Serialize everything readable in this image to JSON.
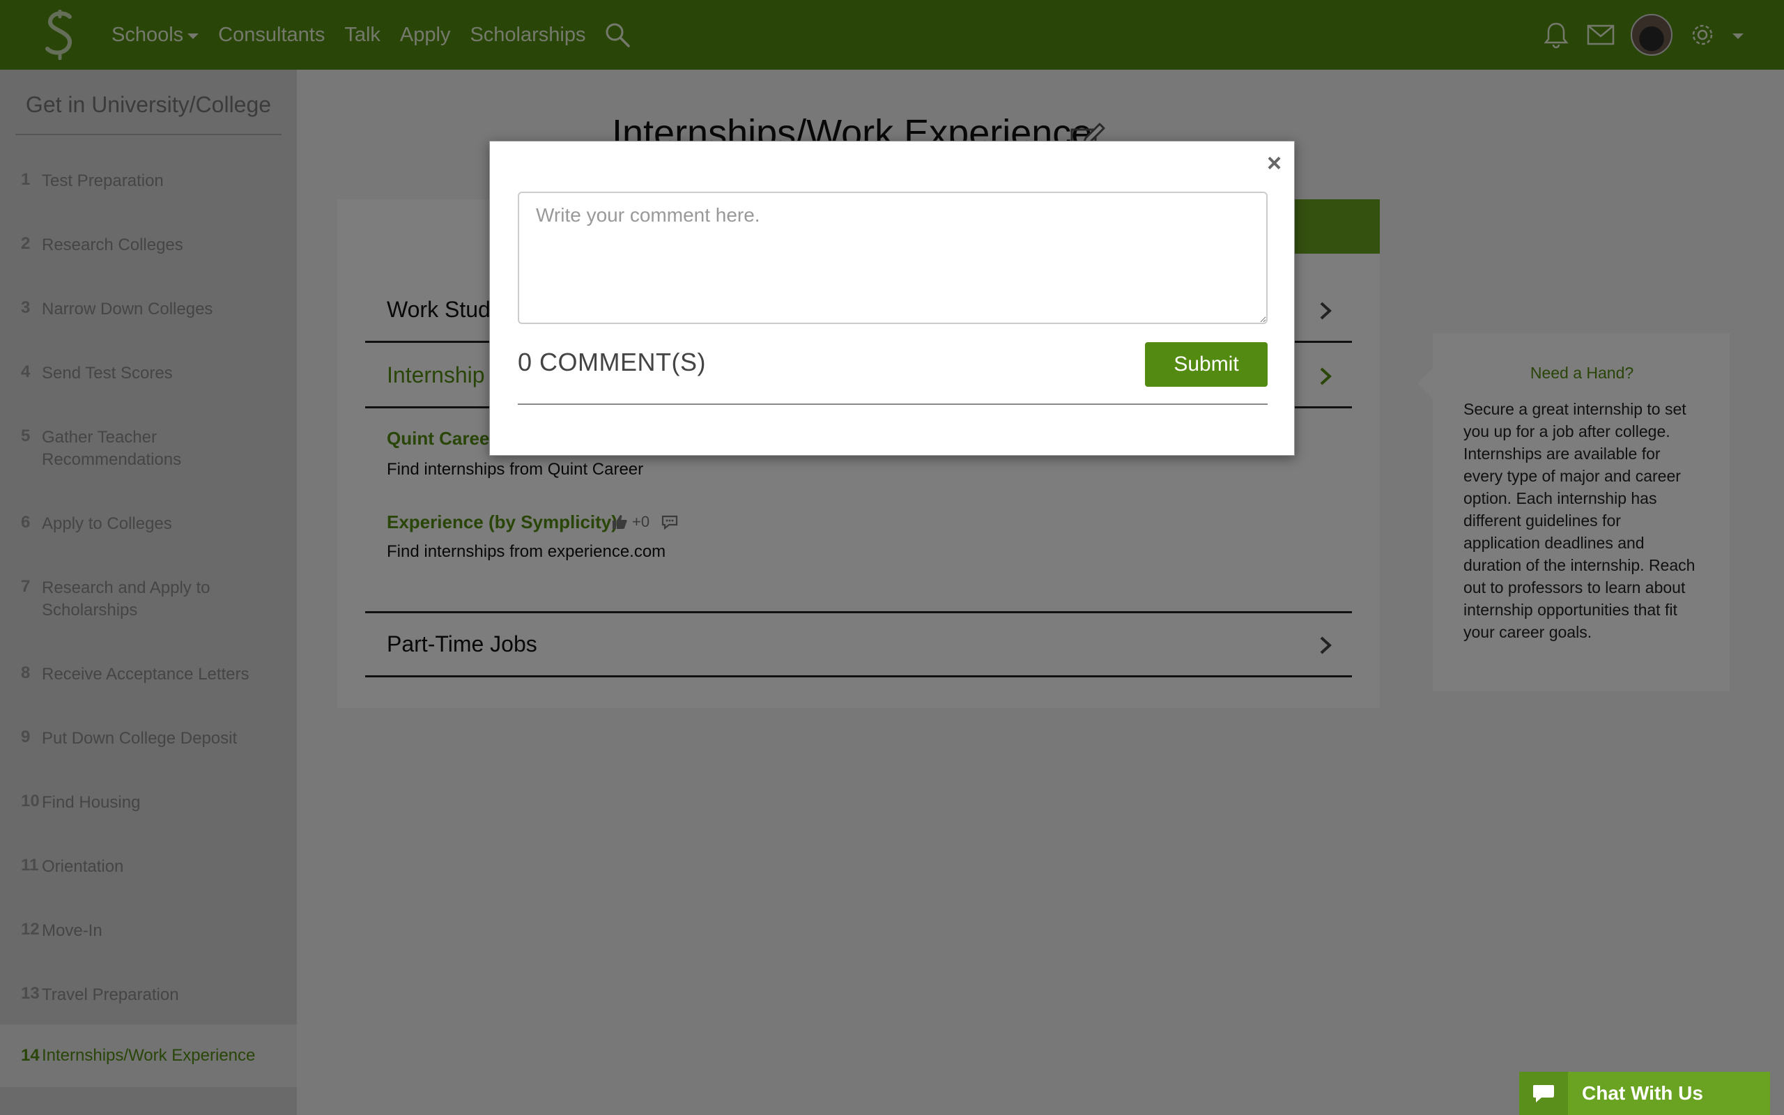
{
  "nav": {
    "links": [
      {
        "label": "Schools"
      },
      {
        "label": "Consultants"
      },
      {
        "label": "Talk"
      },
      {
        "label": "Apply"
      },
      {
        "label": "Scholarships"
      }
    ],
    "brand_color": "#538a11"
  },
  "sidebar": {
    "title": "Get in University/College",
    "items": [
      {
        "num": "1",
        "label": "Test Preparation"
      },
      {
        "num": "2",
        "label": "Research Colleges"
      },
      {
        "num": "3",
        "label": "Narrow Down Colleges"
      },
      {
        "num": "4",
        "label": "Send Test Scores"
      },
      {
        "num": "5",
        "label": "Gather Teacher Recommendations"
      },
      {
        "num": "6",
        "label": "Apply to Colleges"
      },
      {
        "num": "7",
        "label": "Research and Apply to Scholarships"
      },
      {
        "num": "8",
        "label": "Receive Acceptance Letters"
      },
      {
        "num": "9",
        "label": "Put Down College Deposit"
      },
      {
        "num": "10",
        "label": "Find Housing"
      },
      {
        "num": "11",
        "label": "Orientation"
      },
      {
        "num": "12",
        "label": "Move-In"
      },
      {
        "num": "13",
        "label": "Travel Preparation"
      },
      {
        "num": "14",
        "label": "Internships/Work Experience"
      }
    ]
  },
  "main": {
    "title": "Internships/Work Experience",
    "sections": [
      {
        "label": "Work Stud"
      },
      {
        "label": "Internship"
      },
      {
        "label": "Part-Time Jobs"
      }
    ],
    "resources": [
      {
        "title": "Quint Career",
        "desc": "Find internships from Quint Career"
      },
      {
        "title": "Experience (by Symplicity)",
        "likes": "+0",
        "desc": "Find internships from experience.com"
      }
    ]
  },
  "help": {
    "title": "Need a Hand?",
    "text": "Secure a great internship to set you up for a job after college. Internships are available for every type of major and career option. Each internship has different guidelines for application deadlines and duration of the internship. Reach out to professors to learn about internship opportunities that fit your career goals."
  },
  "modal": {
    "close": "×",
    "placeholder": "Write your comment here.",
    "count": "0 COMMENT(S)",
    "submit": "Submit"
  },
  "chat": {
    "label": "Chat With Us"
  }
}
